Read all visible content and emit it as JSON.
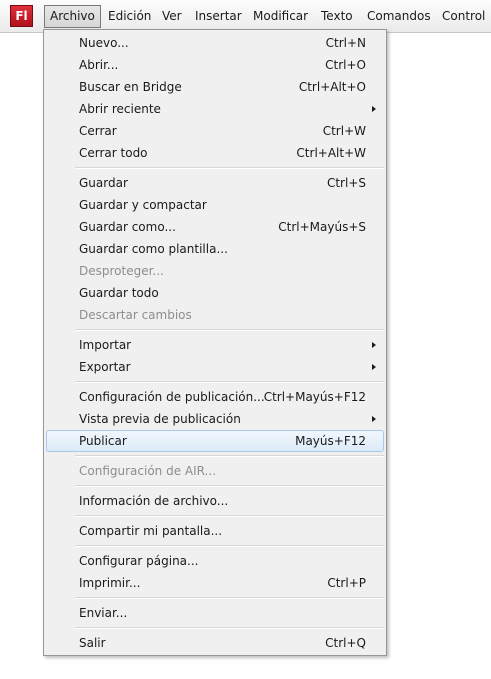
{
  "menubar": {
    "logo_text": "Fl",
    "items": [
      {
        "label": "Archivo"
      },
      {
        "label": "Edición"
      },
      {
        "label": "Ver"
      },
      {
        "label": "Insertar"
      },
      {
        "label": "Modificar"
      },
      {
        "label": "Texto"
      },
      {
        "label": "Comandos"
      },
      {
        "label": "Control"
      }
    ]
  },
  "menu": {
    "items": [
      {
        "label": "Nuevo...",
        "shortcut": "Ctrl+N"
      },
      {
        "label": "Abrir...",
        "shortcut": "Ctrl+O"
      },
      {
        "label": "Buscar en Bridge",
        "shortcut": "Ctrl+Alt+O"
      },
      {
        "label": "Abrir reciente",
        "submenu": true
      },
      {
        "label": "Cerrar",
        "shortcut": "Ctrl+W"
      },
      {
        "label": "Cerrar todo",
        "shortcut": "Ctrl+Alt+W"
      },
      {
        "label": "Guardar",
        "shortcut": "Ctrl+S"
      },
      {
        "label": "Guardar y compactar"
      },
      {
        "label": "Guardar como...",
        "shortcut": "Ctrl+Mayús+S"
      },
      {
        "label": "Guardar como plantilla..."
      },
      {
        "label": "Desproteger...",
        "disabled": true
      },
      {
        "label": "Guardar todo"
      },
      {
        "label": "Descartar cambios",
        "disabled": true
      },
      {
        "label": "Importar",
        "submenu": true
      },
      {
        "label": "Exportar",
        "submenu": true
      },
      {
        "label": "Configuración de publicación...",
        "shortcut": "Ctrl+Mayús+F12"
      },
      {
        "label": "Vista previa de publicación",
        "submenu": true
      },
      {
        "label": "Publicar",
        "shortcut": "Mayús+F12",
        "highlighted": true
      },
      {
        "label": "Configuración de AIR...",
        "disabled": true
      },
      {
        "label": "Información de archivo..."
      },
      {
        "label": "Compartir mi pantalla..."
      },
      {
        "label": "Configurar página..."
      },
      {
        "label": "Imprimir...",
        "shortcut": "Ctrl+P"
      },
      {
        "label": "Enviar..."
      },
      {
        "label": "Salir",
        "shortcut": "Ctrl+Q"
      }
    ]
  },
  "colors": {
    "logo": "#c41a24",
    "highlight_border": "#a9c8ea",
    "disabled_text": "#8d8d8d"
  }
}
